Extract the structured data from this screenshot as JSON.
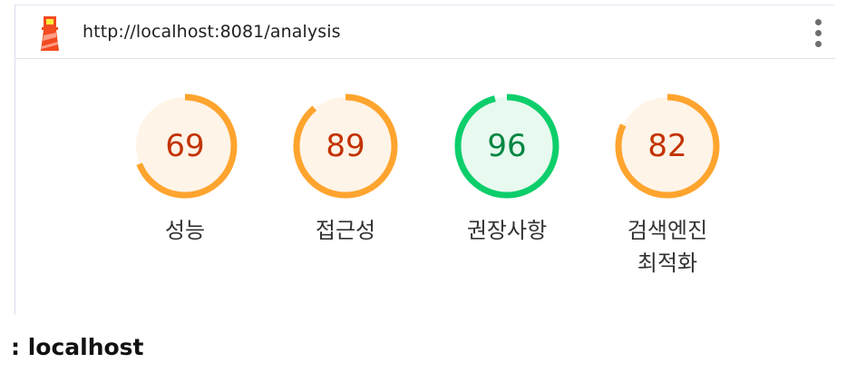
{
  "url_bar": {
    "url": "http://localhost:8081/analysis",
    "logo_icon": "lighthouse-icon",
    "menu_icon": "more-vertical-icon"
  },
  "gauges": [
    {
      "score": 69,
      "label": "성능",
      "status": "average",
      "color": "#ffa42e",
      "text_color": "#c33300",
      "fill": "#fff4e8"
    },
    {
      "score": 89,
      "label": "접근성",
      "status": "average",
      "color": "#ffa42e",
      "text_color": "#c33300",
      "fill": "#fff4e8"
    },
    {
      "score": 96,
      "label": "권장사항",
      "status": "pass",
      "color": "#0cce6b",
      "text_color": "#018642",
      "fill": "#e8f9ef"
    },
    {
      "score": 82,
      "label": "검색엔진\n최적화",
      "status": "average",
      "color": "#ffa42e",
      "text_color": "#c33300",
      "fill": "#fff4e8"
    }
  ],
  "footer": {
    "text": ": localhost"
  }
}
